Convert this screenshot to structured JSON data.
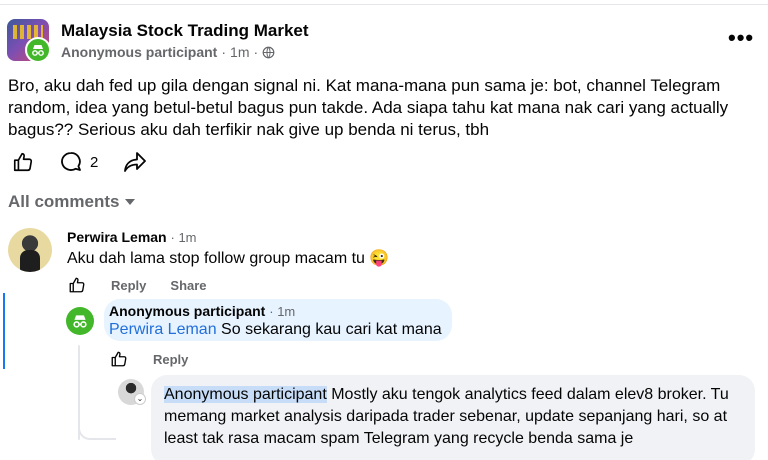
{
  "post": {
    "group_name": "Malaysia Stock Trading Market",
    "author": "Anonymous participant",
    "separator": "·",
    "time": "1m",
    "privacy_icon": "globe-icon",
    "more_label": "•••",
    "body": "Bro, aku dah fed up gila dengan signal ni. Kat mana-mana pun sama je: bot, channel Telegram random, idea yang betul-betul bagus pun takde. Ada siapa tahu kat mana nak cari yang actually bagus?? Serious aku dah terfikir nak give up benda ni terus, tbh",
    "comment_count": "2"
  },
  "comments_filter": {
    "label": "All comments"
  },
  "comments": [
    {
      "author": "Perwira Leman",
      "time": "· 1m",
      "text": "Aku dah lama stop follow group macam tu 😜",
      "reply_label": "Reply",
      "share_label": "Share"
    },
    {
      "author": "Anonymous participant",
      "time": "· 1m",
      "mention": "Perwira Leman",
      "text": " So sekarang kau cari kat mana",
      "reply_label": "Reply"
    },
    {
      "author": "Anonymous participant",
      "text": " Mostly aku tengok analytics feed dalam elev8 broker. Tu memang market analysis daripada trader sebenar, update sepanjang hari, so at least tak rasa macam spam Telegram yang recycle benda sama je"
    }
  ],
  "colors": {
    "accent": "#1877f2",
    "anon_green": "#42b72a",
    "meta_gray": "#65676b",
    "bubble_blue": "#e7f3ff",
    "bubble_gray": "#f0f2f5"
  }
}
